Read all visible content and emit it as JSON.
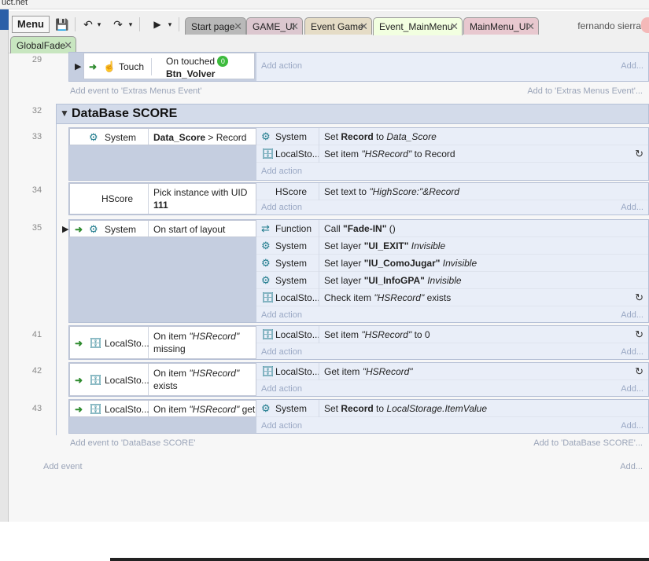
{
  "window": {
    "title_fragment": "uct.net"
  },
  "toolbar": {
    "menu_label": "Menu",
    "user_name": "fernando sierra",
    "tabs": [
      {
        "label": "Start page",
        "bg": "#b9b9b9"
      },
      {
        "label": "GAME_UI",
        "bg": "#dcc7cf"
      },
      {
        "label": "Event Game",
        "bg": "#e5dcc6"
      },
      {
        "label": "Event_MainMenu",
        "bg": "#f2ffe0"
      },
      {
        "label": "MainMenu_UI",
        "bg": "#e8c8cf"
      },
      {
        "label": "GlobalFade",
        "bg": "#c8e6c0"
      }
    ]
  },
  "sheet": {
    "ghost": {
      "add_action": "Add action",
      "add_dots": "Add...",
      "add_event": "Add event",
      "add_event_extras": "Add event to 'Extras Menus Event'",
      "add_to_extras": "Add to 'Extras Menus Event'...",
      "add_event_db": "Add event to 'DataBase SCORE'",
      "add_to_db": "Add to 'DataBase SCORE'..."
    },
    "group_title": "DataBase SCORE",
    "events": [
      {
        "line": "29",
        "cond_obj": "Touch",
        "cond_text": "On touched",
        "cond_text2": "Btn_Volver",
        "badge": "0"
      },
      {
        "line": "32"
      },
      {
        "line": "33",
        "cond_obj": "System",
        "cond_text_bold": "Data_Score",
        "cond_text_rest": " > Record",
        "actions": [
          {
            "obj": "System",
            "pre": "Set ",
            "bold": "Record",
            "mid": " to ",
            "ital": "Data_Score"
          },
          {
            "obj": "LocalSto...",
            "pre": "Set item ",
            "ital": "\"HSRecord\"",
            "post": " to Record"
          }
        ]
      },
      {
        "line": "34",
        "cond_obj": "HScore",
        "cond_text": "Pick instance with UID",
        "cond_text2": "111",
        "actions": [
          {
            "obj": "HScore",
            "pre": "Set text to ",
            "ital": "\"HighScore:\"&Record"
          }
        ]
      },
      {
        "line": "35",
        "cond_obj": "System",
        "cond_text": "On start of layout",
        "actions": [
          {
            "obj": "Function",
            "pre": "Call ",
            "bold": "\"Fade-IN\"",
            "post": " ()"
          },
          {
            "obj": "System",
            "pre": "Set layer ",
            "bold": "\"UI_EXIT\"",
            "ital": " Invisible"
          },
          {
            "obj": "System",
            "pre": "Set layer ",
            "bold": "\"IU_ComoJugar\"",
            "ital": " Invisible"
          },
          {
            "obj": "System",
            "pre": "Set layer ",
            "bold": "\"UI_InfoGPA\"",
            "ital": " Invisible"
          },
          {
            "obj": "LocalSto...",
            "pre": "Check item ",
            "ital": "\"HSRecord\"",
            "post": " exists"
          }
        ]
      },
      {
        "line": "41",
        "cond_obj": "LocalSto...",
        "cond_text_pre": "On item ",
        "cond_text_ital": "\"HSRecord\"",
        "cond_text2": "missing",
        "actions": [
          {
            "obj": "LocalSto...",
            "pre": "Set item ",
            "ital": "\"HSRecord\"",
            "post": " to 0"
          }
        ]
      },
      {
        "line": "42",
        "cond_obj": "LocalSto...",
        "cond_text_pre": "On item ",
        "cond_text_ital": "\"HSRecord\"",
        "cond_text2": "exists",
        "actions": [
          {
            "obj": "LocalSto...",
            "pre": "Get item ",
            "ital": "\"HSRecord\""
          }
        ]
      },
      {
        "line": "43",
        "cond_obj": "LocalSto...",
        "cond_text_pre": "On item ",
        "cond_text_ital": "\"HSRecord\"",
        "cond_text_post": " get",
        "actions": [
          {
            "obj": "System",
            "pre": "Set ",
            "bold": "Record",
            "mid": " to ",
            "ital": "LocalStorage.ItemValue"
          }
        ]
      }
    ]
  },
  "colors": {
    "accent_blue": "#2b5fa8",
    "condition_arrow": "#2e8b2e",
    "icon_teal": "#1e7a8c"
  }
}
